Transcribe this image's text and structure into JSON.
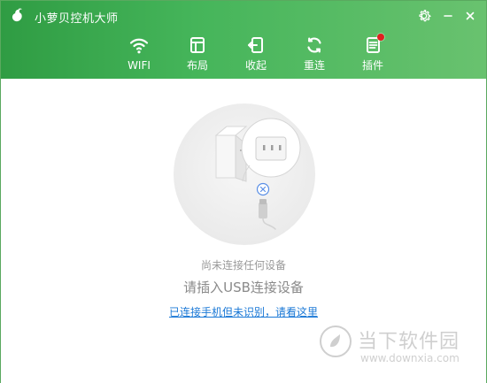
{
  "window": {
    "title": "小萝贝控机大师"
  },
  "toolbar": {
    "items": [
      {
        "label": "WIFI"
      },
      {
        "label": "布局"
      },
      {
        "label": "收起"
      },
      {
        "label": "重连"
      },
      {
        "label": "插件"
      }
    ]
  },
  "main": {
    "status_line1": "尚未连接任何设备",
    "status_line2": "请插入USB连接设备",
    "help_link": "已连接手机但未识别，请看这里"
  },
  "watermark": {
    "text": "当下软件园",
    "url": "www.downxia.com"
  },
  "colors": {
    "header_green_dark": "#2f9c43",
    "header_green_mid": "#45b55a",
    "header_green_light": "#69c26f",
    "link_blue": "#1a78d6",
    "badge_red": "#e02020"
  },
  "icons": {
    "app": "radish-logo-icon",
    "settings": "gear-icon",
    "minimize": "minimize-icon",
    "close": "close-icon",
    "wifi": "wifi-icon",
    "layout": "layout-icon",
    "collapse": "collapse-icon",
    "reconnect": "reconnect-icon",
    "plugins": "plugins-icon"
  }
}
